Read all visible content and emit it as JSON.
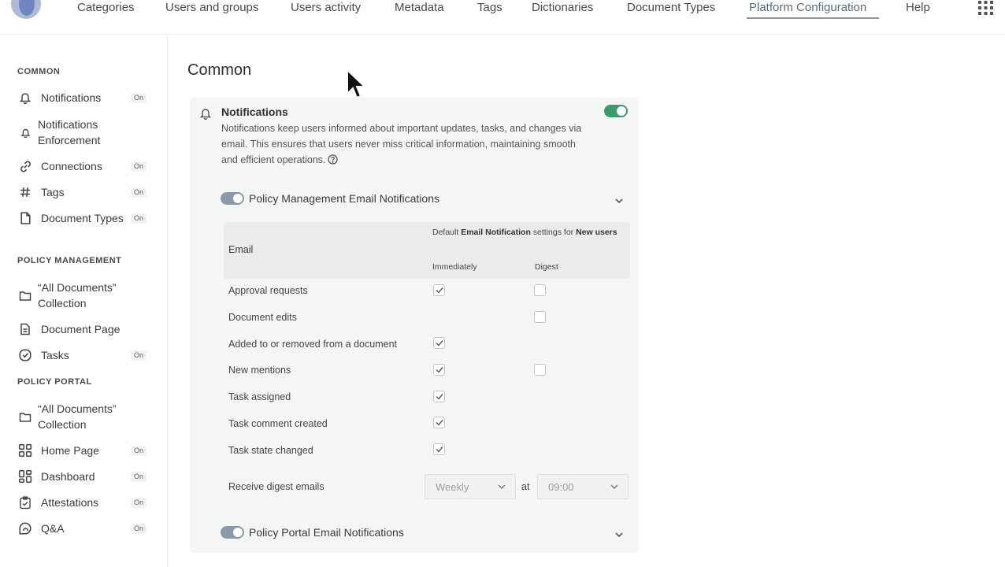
{
  "nav": {
    "items": [
      "Categories",
      "Users and groups",
      "Users activity",
      "Metadata",
      "Tags",
      "Dictionaries",
      "Document Types",
      "Platform Configuration",
      "Help"
    ],
    "active": "Platform Configuration",
    "apps_icon": "grid-icon"
  },
  "sidebar": {
    "sections": [
      {
        "title": "COMMON",
        "items": [
          {
            "label": "Notifications",
            "icon": "bell-icon",
            "badge": "On"
          },
          {
            "label": "Notifications Enforcement",
            "icon": "bell-icon",
            "badge": ""
          },
          {
            "label": "Connections",
            "icon": "link-icon",
            "badge": "On"
          },
          {
            "label": "Tags",
            "icon": "hash-icon",
            "badge": "On"
          },
          {
            "label": "Document Types",
            "icon": "document-icon",
            "badge": "On"
          }
        ]
      },
      {
        "title": "POLICY MANAGEMENT",
        "items": [
          {
            "label": "“All Documents” Collection",
            "icon": "folder-icon",
            "badge": ""
          },
          {
            "label": "Document Page",
            "icon": "page-icon",
            "badge": ""
          },
          {
            "label": "Tasks",
            "icon": "check-circle-icon",
            "badge": "On"
          }
        ]
      },
      {
        "title": "POLICY PORTAL",
        "items": [
          {
            "label": "“All Documents” Collection",
            "icon": "folder-icon",
            "badge": ""
          },
          {
            "label": "Home Page",
            "icon": "home-grid-icon",
            "badge": "On"
          },
          {
            "label": "Dashboard",
            "icon": "dashboard-icon",
            "badge": "On"
          },
          {
            "label": "Attestations",
            "icon": "clipboard-check-icon",
            "badge": "On"
          },
          {
            "label": "Q&A",
            "icon": "qa-icon",
            "badge": "On"
          }
        ]
      }
    ]
  },
  "main": {
    "title": "Common",
    "card": {
      "title": "Notifications",
      "description": "Notifications keep users informed about important updates, tasks, and changes via email. This ensures that users never miss critical information, maintaining smooth and efficient operations.",
      "enabled": true,
      "pm_section": {
        "title": "Policy Management Email Notifications",
        "enabled": true,
        "table": {
          "col_email": "Email",
          "default_prefix": "Default ",
          "default_bold1": "Email Notification",
          "default_mid": " settings for ",
          "default_bold2": "New users",
          "col_immediately": "Immediately",
          "col_digest": "Digest",
          "rows": [
            {
              "label": "Approval requests",
              "immediately": true,
              "digest": false,
              "has_digest": true
            },
            {
              "label": "Document edits",
              "immediately": null,
              "digest": false,
              "has_digest": true
            },
            {
              "label": "Added to or removed from a document",
              "immediately": true,
              "digest": null,
              "has_digest": false
            },
            {
              "label": "New mentions",
              "immediately": true,
              "digest": false,
              "has_digest": true
            },
            {
              "label": "Task assigned",
              "immediately": true,
              "digest": null,
              "has_digest": false
            },
            {
              "label": "Task comment created",
              "immediately": true,
              "digest": null,
              "has_digest": false
            },
            {
              "label": "Task state changed",
              "immediately": true,
              "digest": null,
              "has_digest": false
            }
          ]
        },
        "digest": {
          "label": "Receive digest emails",
          "frequency": "Weekly",
          "at": "at",
          "time": "09:00"
        }
      },
      "pp_section": {
        "title": "Policy Portal Email Notifications",
        "enabled": true
      }
    }
  }
}
